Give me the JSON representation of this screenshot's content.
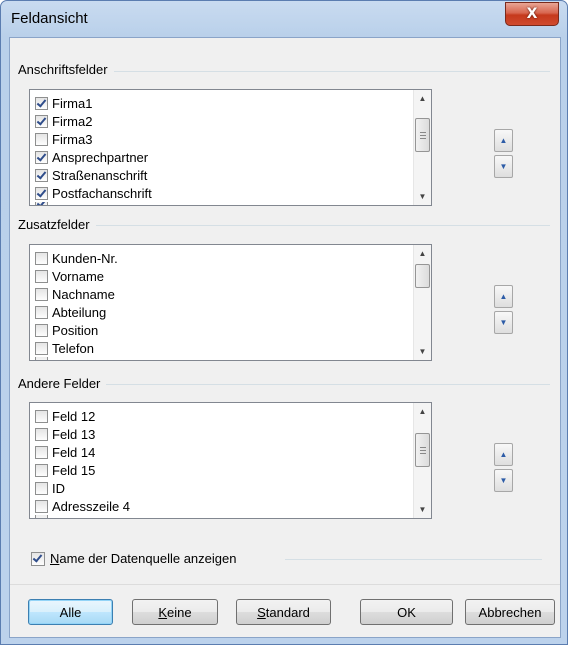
{
  "window": {
    "title": "Feldansicht",
    "close_glyph": "X"
  },
  "groups": [
    {
      "label": "Anschriftsfelder",
      "items": [
        {
          "label": "Firma1",
          "checked": true
        },
        {
          "label": "Firma2",
          "checked": true
        },
        {
          "label": "Firma3",
          "checked": false
        },
        {
          "label": "Ansprechpartner",
          "checked": true
        },
        {
          "label": "Straßenanschrift",
          "checked": true
        },
        {
          "label": "Postfachanschrift",
          "checked": true
        }
      ]
    },
    {
      "label": "Zusatzfelder",
      "items": [
        {
          "label": "Kunden-Nr.",
          "checked": false
        },
        {
          "label": "Vorname",
          "checked": false
        },
        {
          "label": "Nachname",
          "checked": false
        },
        {
          "label": "Abteilung",
          "checked": false
        },
        {
          "label": "Position",
          "checked": false
        },
        {
          "label": "Telefon",
          "checked": false
        }
      ]
    },
    {
      "label": "Andere Felder",
      "items": [
        {
          "label": "Feld 12",
          "checked": false
        },
        {
          "label": "Feld 13",
          "checked": false
        },
        {
          "label": "Feld 14",
          "checked": false
        },
        {
          "label": "Feld 15",
          "checked": false
        },
        {
          "label": "ID",
          "checked": false
        },
        {
          "label": "Adresszeile 4",
          "checked": false
        }
      ]
    }
  ],
  "show_source": {
    "label_mnemonic": "N",
    "label_rest": "ame der Datenquelle anzeigen",
    "checked": true
  },
  "buttons": {
    "alle": "Alle",
    "keine_mnemonic": "K",
    "keine_rest": "eine",
    "standard_mnemonic": "S",
    "standard_rest": "tandard",
    "ok": "OK",
    "abbrechen": "Abbrechen"
  },
  "colors": {
    "title_bar": "#b9d0ea",
    "close_button": "#c5391c",
    "dialog_bg": "#f0f0f0"
  }
}
